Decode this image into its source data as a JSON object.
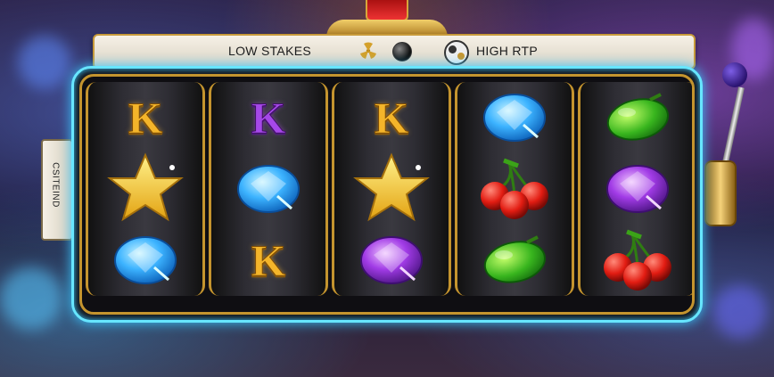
{
  "header": {
    "low_label": "LOW STAKES",
    "high_label": "HIGH RTP",
    "icons": [
      "radiation-icon",
      "dark-orb-icon",
      "coin-orb-icon"
    ]
  },
  "side_tab": {
    "label": "CSITEIND"
  },
  "reels": [
    [
      "k-gold",
      "star",
      "gem-blue"
    ],
    [
      "k-purple",
      "gem-blue",
      "k-gold"
    ],
    [
      "k-gold",
      "star",
      "gem-purple"
    ],
    [
      "gem-blue",
      "cherries",
      "lime"
    ],
    [
      "lime",
      "gem-purple",
      "cherries"
    ]
  ],
  "symbol_text": {
    "k": "K"
  },
  "colors": {
    "frame_glow": "#67e6ff",
    "gold": "#c4942e",
    "lever_knob": "#5b3ad6"
  }
}
